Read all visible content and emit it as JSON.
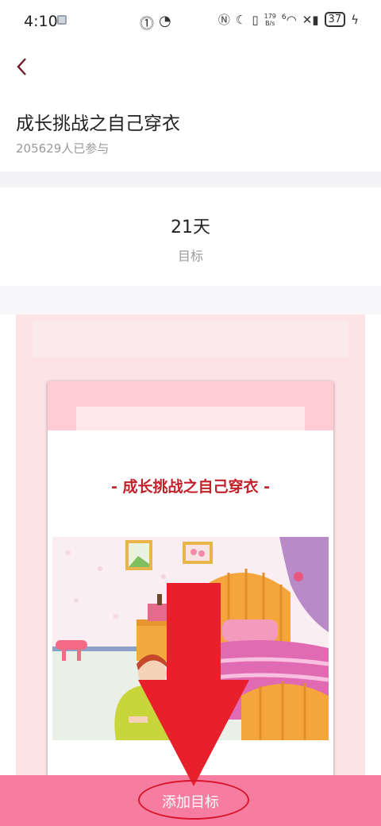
{
  "status_bar": {
    "time": "4:10",
    "network_speed_value": "179",
    "network_speed_unit": "B/s",
    "signal_label": "6",
    "battery": "37"
  },
  "header": {
    "back_icon": "chevron-left-icon",
    "title": "成长挑战之自己穿衣",
    "participants": "205629人已参与"
  },
  "goal": {
    "value": "21天",
    "label": "目标"
  },
  "poster": {
    "card_title": "- 成长挑战之自己穿衣 -"
  },
  "bottom": {
    "add_button_label": "添加目标"
  },
  "colors": {
    "accent": "#f67da0",
    "poster_bg": "#fde3e6",
    "card_title": "#c0212a",
    "annotation_red": "#e8202b"
  }
}
